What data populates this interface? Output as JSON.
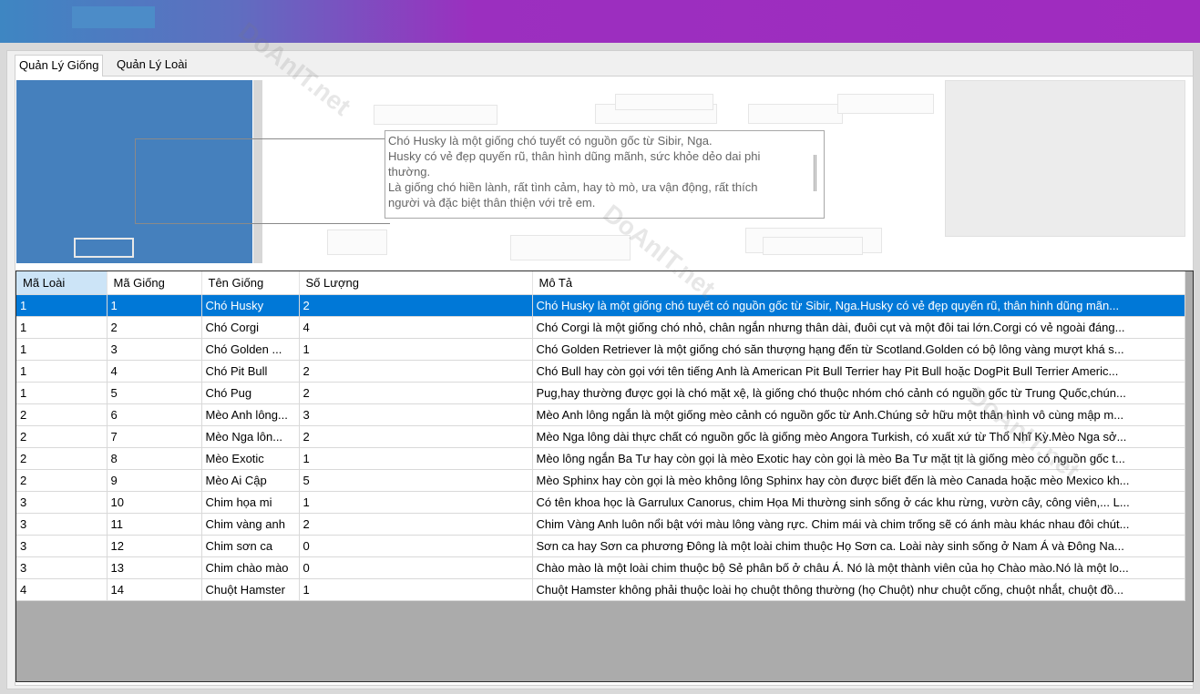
{
  "tabs": [
    {
      "label": "Quản Lý Giống"
    },
    {
      "label": "Quản Lý Loài"
    }
  ],
  "description_preview": [
    "Chó Husky là một giống chó tuyết có nguồn gốc từ Sibir, Nga.",
    "Husky có vẻ đẹp quyến rũ, thân hình dũng mãnh, sức khỏe dẻo dai phi",
    "thường.",
    "Là giống chó hiền lành, rất tình cảm, hay tò mò, ưa vận động, rất thích",
    "người và đặc biệt thân thiện với trẻ em."
  ],
  "grid": {
    "columns": [
      "Mã Loài",
      "Mã Giống",
      "Tên Giống",
      "Số Lượng",
      "Mô Tả"
    ],
    "rows": [
      [
        "1",
        "1",
        "Chó Husky",
        "2",
        "Chó Husky là một giống chó tuyết có nguồn gốc từ Sibir, Nga.Husky có vẻ đẹp quyến rũ, thân hình dũng mãn..."
      ],
      [
        "1",
        "2",
        "Chó Corgi",
        "4",
        "Chó Corgi là một giống chó nhỏ, chân ngắn nhưng thân dài, đuôi cụt và một đôi tai lớn.Corgi có vẻ ngoài đáng..."
      ],
      [
        "1",
        "3",
        "Chó Golden ...",
        "1",
        "Chó Golden Retriever là một giống chó săn thượng hạng đến từ Scotland.Golden có bộ lông vàng mượt khá s..."
      ],
      [
        "1",
        "4",
        "Chó Pit Bull",
        "2",
        "Chó Bull hay còn gọi với tên tiếng Anh là American Pit Bull Terrier hay Pit Bull hoặc DogPit Bull Terrier Americ..."
      ],
      [
        "1",
        "5",
        "Chó Pug",
        "2",
        "Pug,hay thường được gọi là chó mặt xệ, là giống chó thuộc nhóm chó cảnh có nguồn gốc từ Trung Quốc,chún..."
      ],
      [
        "2",
        "6",
        "Mèo Anh lông...",
        "3",
        "Mèo Anh lông ngắn là một giống mèo cảnh có nguồn gốc từ Anh.Chúng sở hữu một thân hình vô cùng mập m..."
      ],
      [
        "2",
        "7",
        "Mèo Nga lôn...",
        "2",
        "Mèo Nga lông dài thực chất có nguồn gốc là giống mèo Angora Turkish, có xuất xứ từ Thổ Nhĩ Kỳ.Mèo Nga sở..."
      ],
      [
        "2",
        "8",
        "Mèo Exotic",
        "1",
        "Mèo lông ngắn Ba Tư hay còn gọi là mèo Exotic hay còn gọi là mèo Ba Tư mặt tịt là giống mèo có nguồn gốc t..."
      ],
      [
        "2",
        "9",
        "Mèo Ai Cập",
        "5",
        "Mèo Sphinx hay còn gọi là mèo không lông Sphinx hay còn được biết đến là mèo Canada hoặc mèo Mexico kh..."
      ],
      [
        "3",
        "10",
        "Chim họa mi",
        "1",
        "Có tên khoa học là Garrulux Canorus, chim Họa Mi thường sinh sống ở các khu rừng, vườn cây, công viên,... L..."
      ],
      [
        "3",
        "11",
        "Chim vàng anh",
        "2",
        "Chim Vàng Anh luôn nổi bật với màu lông vàng rực. Chim mái và chim trống sẽ có ánh màu khác nhau đôi chút..."
      ],
      [
        "3",
        "12",
        "Chim sơn ca",
        "0",
        "Sơn ca hay Sơn ca phương Đông là một loài chim thuộc Họ Sơn ca. Loài này sinh sống ở Nam Á và Đông Na..."
      ],
      [
        "3",
        "13",
        "Chim chào mào",
        "0",
        "Chào mào là một loài chim thuộc bộ Sẻ phân bố ở châu Á. Nó là một thành viên của họ Chào mào.Nó là một lo..."
      ],
      [
        "4",
        "14",
        "Chuột Hamster",
        "1",
        "Chuột Hamster không phải thuộc loài họ chuột thông thường (họ Chuột) như chuột cống, chuột nhắt, chuột đồ..."
      ]
    ],
    "selected_row": 0
  },
  "watermark": "DoAnIT.net",
  "colors": {
    "selection": "#0078d7",
    "header_sorted": "#cce4f7",
    "image_box": "#4580bd",
    "top_bar": "#a02bbf"
  }
}
